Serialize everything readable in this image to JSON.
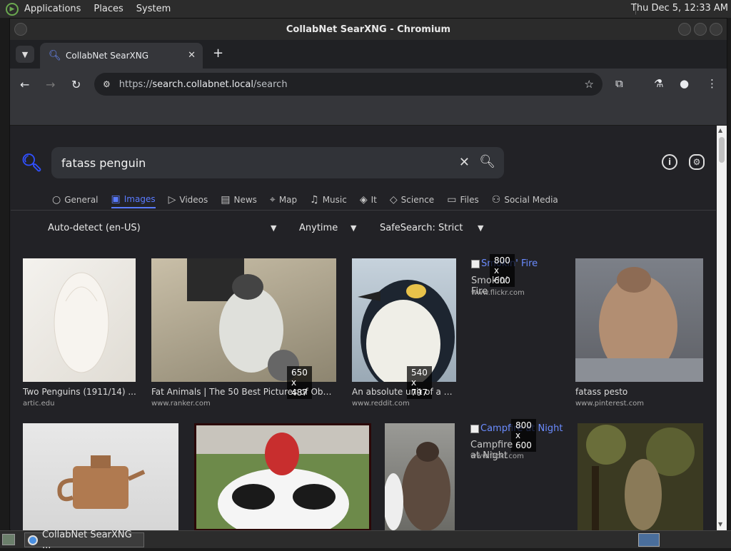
{
  "panel": {
    "menus": [
      "Applications",
      "Places",
      "System"
    ],
    "clock": "Thu Dec  5, 12:33 AM"
  },
  "window": {
    "title": "CollabNet SearXNG - Chromium"
  },
  "tabs": [
    {
      "label": "CollabNet SearXNG",
      "close": "✕"
    }
  ],
  "newtab": "+",
  "address": {
    "scheme": "https://",
    "host": "search.collabnet.local",
    "path": "/search"
  },
  "search": {
    "query": "fatass penguin",
    "categories": [
      {
        "label": "General",
        "icon": "search-icon",
        "active": false
      },
      {
        "label": "Images",
        "icon": "image-icon",
        "active": true
      },
      {
        "label": "Videos",
        "icon": "play-icon",
        "active": false
      },
      {
        "label": "News",
        "icon": "newspaper-icon",
        "active": false
      },
      {
        "label": "Map",
        "icon": "map-pin-icon",
        "active": false
      },
      {
        "label": "Music",
        "icon": "music-note-icon",
        "active": false
      },
      {
        "label": "It",
        "icon": "layers-icon",
        "active": false
      },
      {
        "label": "Science",
        "icon": "graduation-cap-icon",
        "active": false
      },
      {
        "label": "Files",
        "icon": "inbox-icon",
        "active": false
      },
      {
        "label": "Social Media",
        "icon": "people-icon",
        "active": false
      }
    ],
    "filters": {
      "language": "Auto-detect (en-US)",
      "time": "Anytime",
      "safesearch": "SafeSearch: Strict"
    }
  },
  "results": [
    {
      "title": "Two Penguins (1911/14) ...",
      "url": "artic.edu",
      "resolution": ""
    },
    {
      "title": "Fat Animals | The 50 Best Pictures of Obe...",
      "url": "www.ranker.com",
      "resolution": "650 x 487"
    },
    {
      "title": "An absolute unit of a p...",
      "url": "www.reddit.com",
      "resolution": "540 x 797"
    },
    {
      "title": "Smokin' Fire",
      "url": "www.flickr.com",
      "resolution": "800 x 600",
      "alt": "Smokin' Fire"
    },
    {
      "title": "fatass pesto",
      "url": "www.pinterest.com",
      "resolution": ""
    },
    {
      "title": "",
      "url": "",
      "resolution": ""
    },
    {
      "title": "",
      "url": "",
      "resolution": ""
    },
    {
      "title": "",
      "url": "",
      "resolution": ""
    },
    {
      "title": "Campfire at Night",
      "url": "www.flickr.com",
      "resolution": "800 x 600",
      "alt": "Campfire at Night"
    },
    {
      "title": "",
      "url": "",
      "resolution": ""
    }
  ],
  "taskbar": {
    "task_label": "CollabNet SearXNG ..."
  }
}
